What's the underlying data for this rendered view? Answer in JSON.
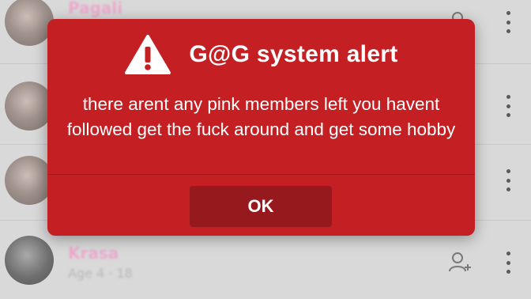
{
  "list": {
    "rows": [
      {
        "name": "Pagali",
        "meta": ""
      },
      {
        "name": "",
        "meta": ""
      },
      {
        "name": "",
        "meta": ""
      },
      {
        "name": "Krasa",
        "meta": "Age 4 · 18"
      }
    ]
  },
  "alert": {
    "icon": "warning-icon",
    "title": "G@G system alert",
    "message": "there arent any pink members left you havent followed get the fuck around and get some hobby",
    "ok_label": "OK",
    "accent": "#c41f22"
  }
}
